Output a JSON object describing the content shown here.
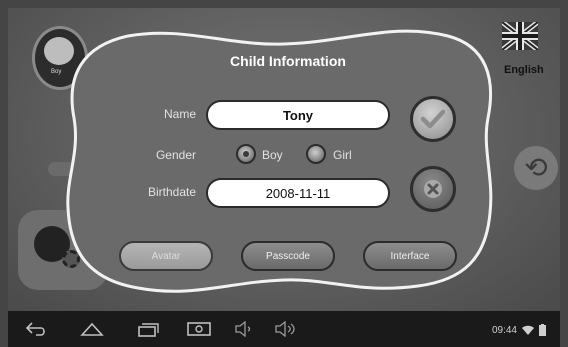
{
  "dialog": {
    "title": "Child Information",
    "name_label": "Name",
    "name_value": "Tony",
    "gender_label": "Gender",
    "gender_options": [
      "Boy",
      "Girl"
    ],
    "gender_selected": "Boy",
    "birthdate_label": "Birthdate",
    "birthdate_value": "2008-11-11",
    "buttons": {
      "avatar": "Avatar",
      "passcode": "Passcode",
      "interface": "Interface"
    },
    "ok_icon": "checkmark-icon",
    "cancel_icon": "x-icon"
  },
  "background": {
    "language_label": "English",
    "avatar_tag": "Boy"
  },
  "status_bar": {
    "time": "09:44"
  },
  "nav_icons": [
    "back-icon",
    "home-icon",
    "recent-apps-icon",
    "screenshot-icon",
    "volume-down-icon",
    "volume-up-icon"
  ]
}
